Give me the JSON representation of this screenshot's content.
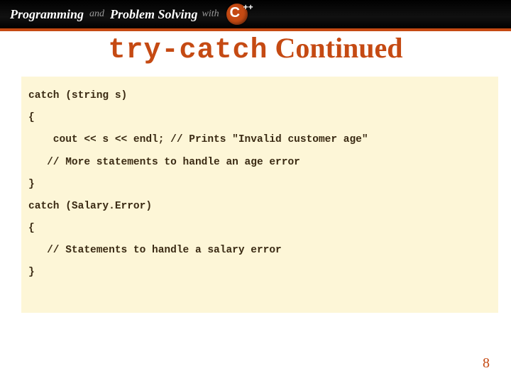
{
  "header": {
    "word1": "Programming",
    "and": "and",
    "word2": "Problem Solving",
    "with": "with",
    "cpp_c": "C",
    "cpp_pp": "++"
  },
  "title": {
    "mono": "try-catch",
    "rest": " Continued"
  },
  "code": {
    "l1": "catch (string s)",
    "l2": "{",
    "l3": "    cout << s << endl; // Prints \"Invalid customer age\"",
    "l4": "   // More statements to handle an age error",
    "l5": "}",
    "l6": "catch (Salary.Error)",
    "l7": "{",
    "l8": "   // Statements to handle a salary error",
    "l9": "}"
  },
  "page_number": "8"
}
